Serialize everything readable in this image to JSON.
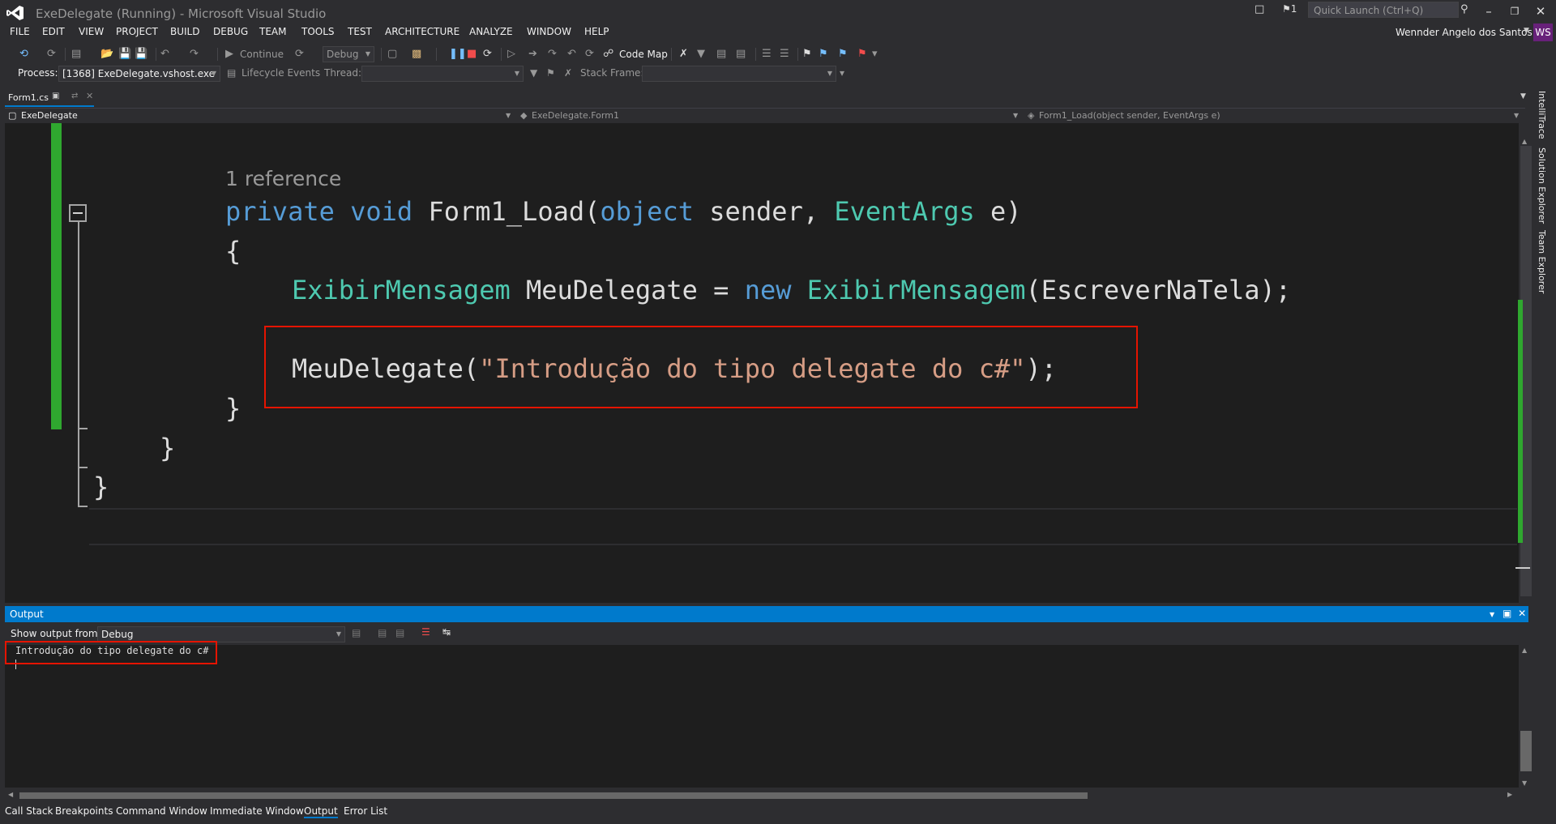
{
  "window": {
    "title": "ExeDelegate (Running) - Microsoft Visual Studio",
    "quick_launch_placeholder": "Quick Launch (Ctrl+Q)",
    "notification_count": "1",
    "user_name": "Wennder Angelo dos Santos",
    "user_initials": "WS",
    "controls": {
      "minimize": "–",
      "restore": "❐",
      "close": "✕"
    }
  },
  "menu": [
    "FILE",
    "EDIT",
    "VIEW",
    "PROJECT",
    "BUILD",
    "DEBUG",
    "TEAM",
    "TOOLS",
    "TEST",
    "ARCHITECTURE",
    "ANALYZE",
    "WINDOW",
    "HELP"
  ],
  "toolbar": {
    "continue_label": "Continue",
    "config_value": "Debug",
    "code_map_label": "Code Map",
    "process_label": "Process:",
    "process_value": "[1368] ExeDelegate.vshost.exe",
    "lifecycle_label": "Lifecycle Events",
    "thread_label": "Thread:",
    "stack_frame_label": "Stack Frame:"
  },
  "document_tab": {
    "name": "Form1.cs"
  },
  "navbar": {
    "project": "ExeDelegate",
    "type": "ExeDelegate.Form1",
    "member": "Form1_Load(object sender, EventArgs e)"
  },
  "code": {
    "reference_lens": "1 reference",
    "line1": {
      "kw1": "private",
      "kw2": "void",
      "name": "Form1_Load(",
      "kw3": "object",
      "p1": "sender,",
      "ty1": "EventArgs",
      "p2": "e)"
    },
    "line2": "{",
    "line3": {
      "ty1": "ExibirMensagem",
      "var": "MeuDelegate =",
      "kw": "new",
      "ty2": "ExibirMensagem",
      "rest": "(EscreverNaTela);"
    },
    "line4": {
      "call": "MeuDelegate(",
      "str": "\"Introdução do tipo delegate do c#\"",
      "end": ");"
    },
    "line5": "}",
    "line6": "}",
    "line7": "}"
  },
  "side_tabs": [
    "IntelliTrace",
    "Solution Explorer",
    "Team Explorer"
  ],
  "output": {
    "title": "Output",
    "show_from_label": "Show output from:",
    "show_from_value": "Debug",
    "text": "Introdução do tipo delegate do c#"
  },
  "bottom_tabs": [
    "Call Stack",
    "Breakpoints",
    "Command Window",
    "Immediate Window",
    "Output",
    "Error List"
  ],
  "colors": {
    "accent": "#007acc",
    "highlight_box": "#e51400",
    "change_bar": "#2fa82f",
    "avatar": "#68217a"
  }
}
